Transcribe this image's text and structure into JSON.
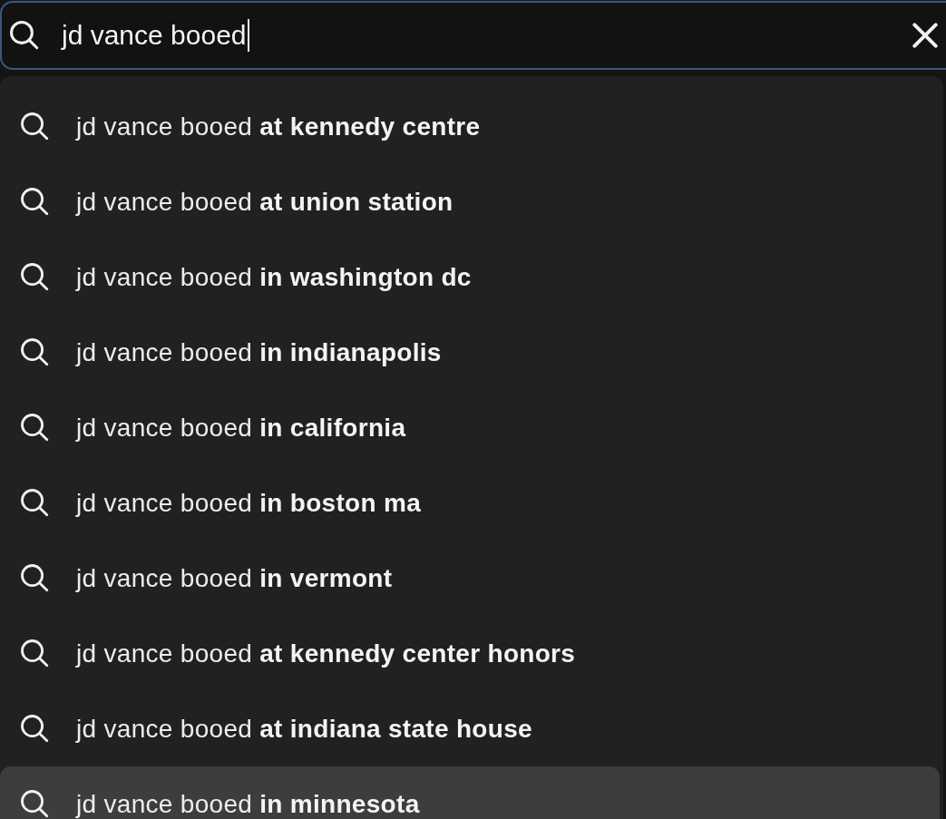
{
  "search": {
    "query": "jd vance booed",
    "focused": true
  },
  "suggestions": [
    {
      "text": "jd vance booed **at kennedy centre**",
      "selected": false
    },
    {
      "text": "jd vance booed **at union station**",
      "selected": false
    },
    {
      "text": "jd vance booed **in washington dc**",
      "selected": false
    },
    {
      "text": "jd vance booed **in indianapolis**",
      "selected": false
    },
    {
      "text": "jd vance booed **in california**",
      "selected": false
    },
    {
      "text": "jd vance booed **in boston ma**",
      "selected": false
    },
    {
      "text": "jd vance booed **in vermont**",
      "selected": false
    },
    {
      "text": "jd vance booed **at kennedy center honors**",
      "selected": false
    },
    {
      "text": "jd vance booed **at indiana state house**",
      "selected": false
    },
    {
      "text": "jd vance booed **in minnesota**",
      "selected": true
    }
  ]
}
